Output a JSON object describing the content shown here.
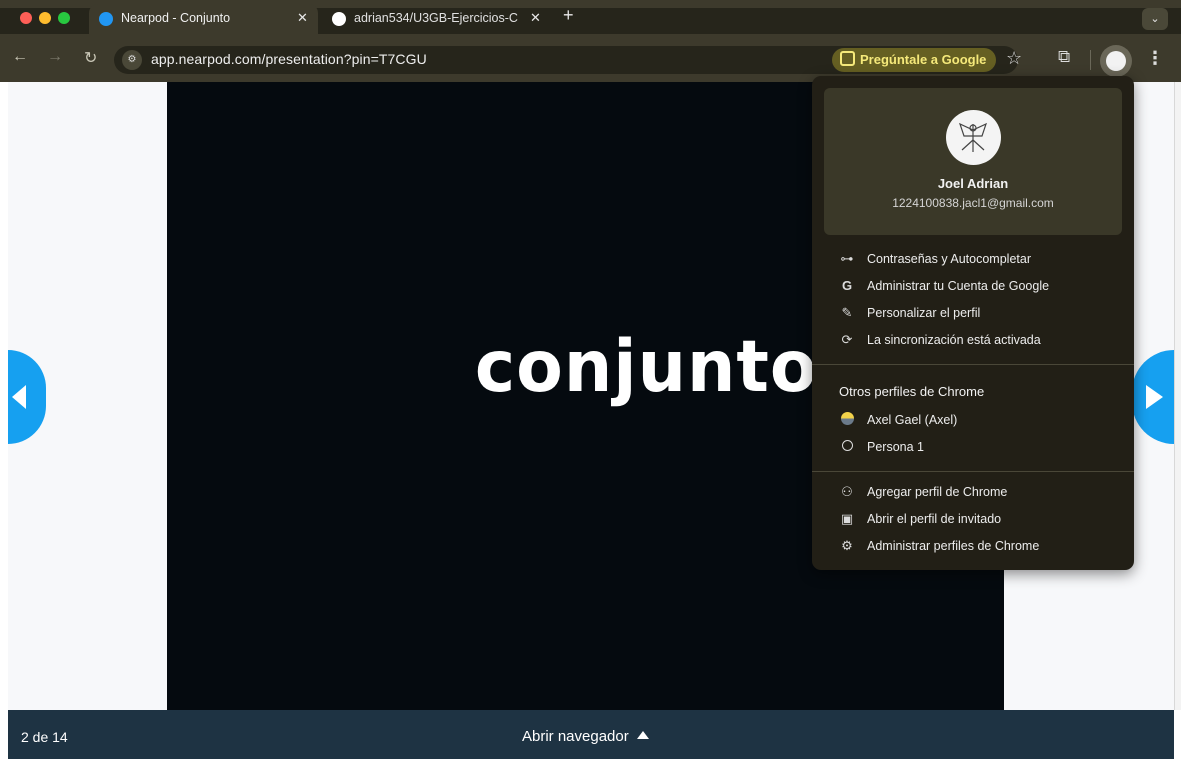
{
  "browser": {
    "tabs": [
      {
        "title": "Nearpod - Conjunto",
        "active": true,
        "favicon_color": "#2196f3"
      },
      {
        "title": "adrian534/U3GB-Ejercicios-C",
        "active": false,
        "favicon_color": "#ffffff"
      }
    ],
    "new_tab_label": "+",
    "address": "app.nearpod.com/presentation?pin=T7CGU",
    "ask_google": "Pregúntale a Google",
    "colors": {
      "frame": "#3d3a2c",
      "tabstrip": "#26251b",
      "accent_yellow": "#f5e97a"
    }
  },
  "slide": {
    "title": "CONJUNTOS",
    "background": "#050a0f",
    "arrow_color": "#16a0f0"
  },
  "bottombar": {
    "page_count": "2 de 14",
    "open_navigator": "Abrir navegador"
  },
  "profile_menu": {
    "name": "Joel Adrian",
    "email": "1224100838.jacl1@gmail.com",
    "items": [
      {
        "label": "Contraseñas y Autocompletar",
        "icon": "key-icon"
      },
      {
        "label": "Administrar tu Cuenta de Google",
        "icon": "google-g-icon"
      },
      {
        "label": "Personalizar el perfil",
        "icon": "pencil-icon"
      },
      {
        "label": "La sincronización está activada",
        "icon": "sync-icon"
      }
    ],
    "other_profiles_heading": "Otros perfiles de Chrome",
    "other_profiles": [
      {
        "label": "Axel Gael (Axel)",
        "icon": "profile-avatar-icon"
      },
      {
        "label": "Persona 1",
        "icon": "person-circle-icon"
      }
    ],
    "actions": [
      {
        "label": "Agregar perfil de Chrome",
        "icon": "add-person-icon"
      },
      {
        "label": "Abrir el perfil de invitado",
        "icon": "guest-icon"
      },
      {
        "label": "Administrar perfiles de Chrome",
        "icon": "manage-profiles-icon"
      }
    ]
  }
}
